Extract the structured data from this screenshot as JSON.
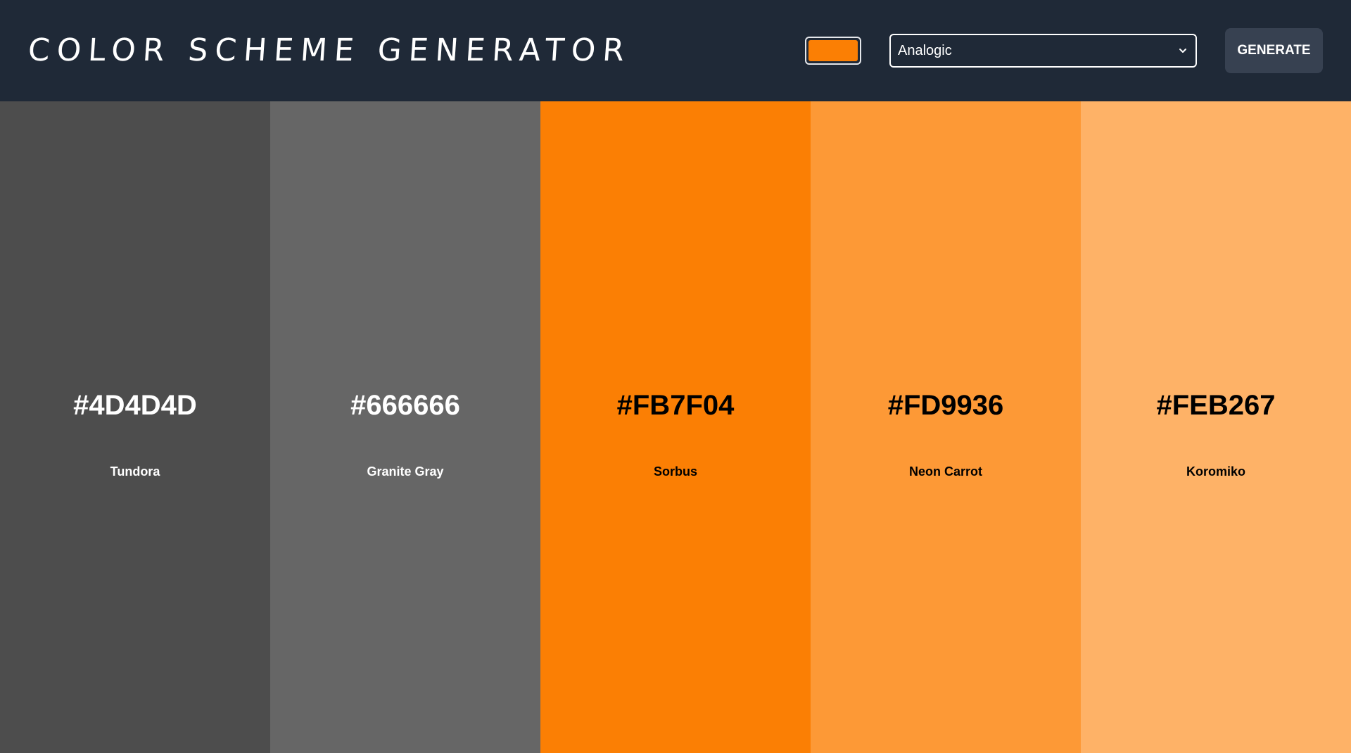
{
  "header": {
    "title": "COLOR SCHEME GENERATOR",
    "seed_color": "#FB7F04",
    "scheme_mode": "Analogic",
    "generate_label": "GENERATE"
  },
  "palette": [
    {
      "hex": "#4D4D4D",
      "name": "Tundora",
      "text_color": "#ffffff"
    },
    {
      "hex": "#666666",
      "name": "Granite Gray",
      "text_color": "#ffffff"
    },
    {
      "hex": "#FB7F04",
      "name": "Sorbus",
      "text_color": "#000000"
    },
    {
      "hex": "#FD9936",
      "name": "Neon Carrot",
      "text_color": "#000000"
    },
    {
      "hex": "#FEB267",
      "name": "Koromiko",
      "text_color": "#000000"
    }
  ],
  "colors": {
    "header_bg": "#1f2937",
    "button_bg": "#374151"
  }
}
